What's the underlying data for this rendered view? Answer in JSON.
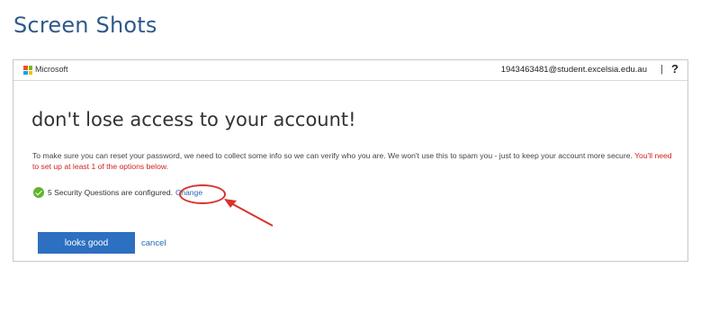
{
  "page": {
    "heading": "Screen Shots"
  },
  "topbar": {
    "brand": "Microsoft",
    "account_email": "1943463481@student.excelsia.edu.au",
    "divider": "|",
    "help_label": "?",
    "logo_colors": [
      "#f25022",
      "#7fba00",
      "#00a4ef",
      "#ffb900"
    ]
  },
  "main": {
    "title": "don't lose access to your account!",
    "description": "To make sure you can reset your password, we need to collect some info so we can verify who you are. We won't use this to spam you - just to keep your account more secure.",
    "warning": "You'll need to set up at least 1 of the options below.",
    "status_text": "5 Security Questions are configured.",
    "change_label": "Change",
    "primary_button_label": "looks good",
    "cancel_label": "cancel"
  },
  "colors": {
    "accent": "#2d6fc0",
    "link": "#2a67b6",
    "warning": "#d11f1f",
    "success": "#5fb52e",
    "annotation": "#d9322b"
  }
}
